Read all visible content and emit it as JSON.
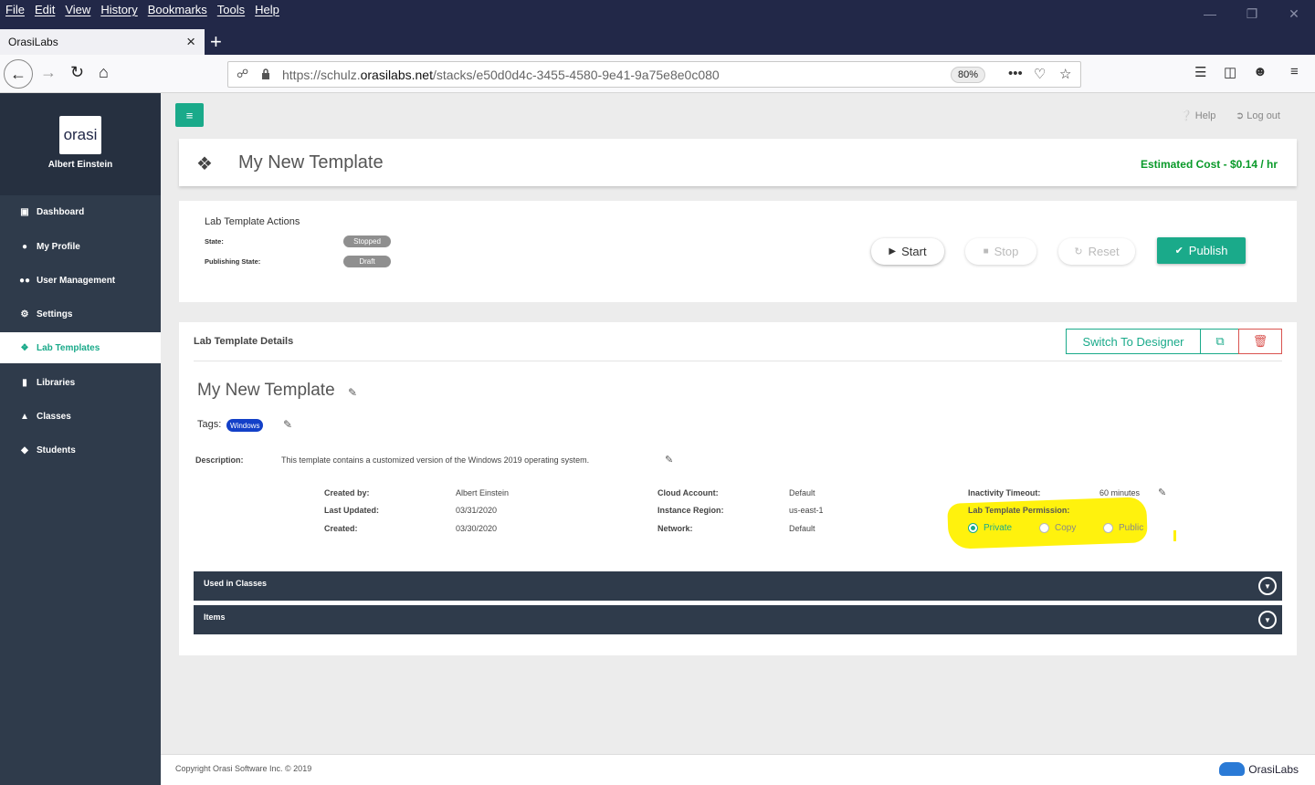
{
  "browser": {
    "menus": [
      "File",
      "Edit",
      "View",
      "History",
      "Bookmarks",
      "Tools",
      "Help"
    ],
    "tab_title": "OrasiLabs",
    "url_prefix": "https://schulz.",
    "url_domain": "orasilabs.net",
    "url_path": "/stacks/e50d0d4c-3455-4580-9e41-9a75e8e0c080",
    "zoom": "80%"
  },
  "sidebar": {
    "user_name": "Albert Einstein",
    "logo_text": "orasi",
    "items": [
      {
        "label": "Dashboard",
        "icon": "monitor-icon"
      },
      {
        "label": "My Profile",
        "icon": "user-icon"
      },
      {
        "label": "User Management",
        "icon": "users-icon"
      },
      {
        "label": "Settings",
        "icon": "gear-icon"
      },
      {
        "label": "Lab Templates",
        "icon": "cubes-icon"
      },
      {
        "label": "Libraries",
        "icon": "book-icon"
      },
      {
        "label": "Classes",
        "icon": "institution-icon"
      },
      {
        "label": "Students",
        "icon": "graduation-cap-icon"
      }
    ]
  },
  "header": {
    "help": "Help",
    "logout": "Log out"
  },
  "title_card": {
    "title": "My New Template",
    "cost": "Estimated Cost - $0.14 / hr"
  },
  "actions": {
    "heading": "Lab Template Actions",
    "state_label": "State:",
    "state_value": "Stopped",
    "publishing_label": "Publishing State:",
    "publishing_value": "Draft",
    "start": "Start",
    "stop": "Stop",
    "reset": "Reset",
    "publish": "Publish"
  },
  "details": {
    "heading": "Lab Template Details",
    "switch_designer": "Switch To Designer",
    "name": "My New Template",
    "tags_label": "Tags:",
    "tags": [
      "Windows"
    ],
    "description_label": "Description:",
    "description": "This template contains a customized version of the Windows 2019 operating system.",
    "created_by_label": "Created by:",
    "created_by": "Albert Einstein",
    "last_updated_label": "Last Updated:",
    "last_updated": "03/31/2020",
    "created_label": "Created:",
    "created": "03/30/2020",
    "cloud_account_label": "Cloud Account:",
    "cloud_account": "Default",
    "region_label": "Instance Region:",
    "region": "us-east-1",
    "network_label": "Network:",
    "network": "Default",
    "inactivity_label": "Inactivity Timeout:",
    "inactivity": "60 minutes",
    "permission_label": "Lab Template Permission:",
    "permission_options": [
      "Private",
      "Copy",
      "Public"
    ],
    "permission_selected": "Private",
    "sections": [
      "Used in Classes",
      "Items"
    ]
  },
  "footer": {
    "copyright": "Copyright Orasi Software Inc. © 2019",
    "brand": "OrasiLabs"
  },
  "colors": {
    "accent": "#1aaa8a",
    "sidebar": "#2f3b4b",
    "browser_chrome": "#222848",
    "cost": "#0a9a2a",
    "tag": "#1340c8",
    "danger": "#d9534f",
    "highlight": "#fff100"
  }
}
